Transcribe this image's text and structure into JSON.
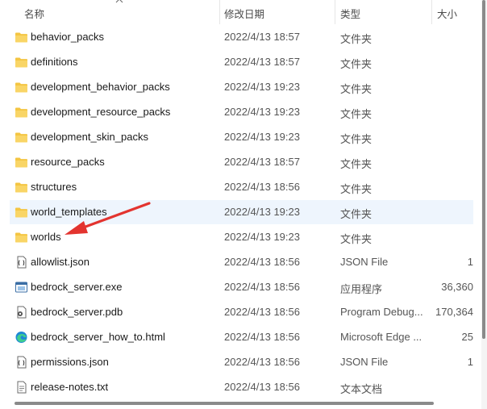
{
  "header": {
    "name": "名称",
    "date": "修改日期",
    "type": "类型",
    "size": "大小"
  },
  "files": [
    {
      "name": "behavior_packs",
      "date": "2022/4/13 18:57",
      "type": "文件夹",
      "size": "",
      "icon": "folder-icon"
    },
    {
      "name": "definitions",
      "date": "2022/4/13 18:57",
      "type": "文件夹",
      "size": "",
      "icon": "folder-icon"
    },
    {
      "name": "development_behavior_packs",
      "date": "2022/4/13 19:23",
      "type": "文件夹",
      "size": "",
      "icon": "folder-icon"
    },
    {
      "name": "development_resource_packs",
      "date": "2022/4/13 19:23",
      "type": "文件夹",
      "size": "",
      "icon": "folder-icon"
    },
    {
      "name": "development_skin_packs",
      "date": "2022/4/13 19:23",
      "type": "文件夹",
      "size": "",
      "icon": "folder-icon"
    },
    {
      "name": "resource_packs",
      "date": "2022/4/13 18:57",
      "type": "文件夹",
      "size": "",
      "icon": "folder-icon"
    },
    {
      "name": "structures",
      "date": "2022/4/13 18:56",
      "type": "文件夹",
      "size": "",
      "icon": "folder-icon"
    },
    {
      "name": "world_templates",
      "date": "2022/4/13 19:23",
      "type": "文件夹",
      "size": "",
      "icon": "folder-icon"
    },
    {
      "name": "worlds",
      "date": "2022/4/13 19:23",
      "type": "文件夹",
      "size": "",
      "icon": "folder-icon"
    },
    {
      "name": "allowlist.json",
      "date": "2022/4/13 18:56",
      "type": "JSON File",
      "size": "1",
      "icon": "json-file-icon"
    },
    {
      "name": "bedrock_server.exe",
      "date": "2022/4/13 18:56",
      "type": "应用程序",
      "size": "36,360",
      "icon": "exe-icon"
    },
    {
      "name": "bedrock_server.pdb",
      "date": "2022/4/13 18:56",
      "type": "Program Debug...",
      "size": "170,364",
      "icon": "pdb-file-icon"
    },
    {
      "name": "bedrock_server_how_to.html",
      "date": "2022/4/13 18:56",
      "type": "Microsoft Edge ...",
      "size": "25",
      "icon": "edge-icon"
    },
    {
      "name": "permissions.json",
      "date": "2022/4/13 18:56",
      "type": "JSON File",
      "size": "1",
      "icon": "json-file-icon"
    },
    {
      "name": "release-notes.txt",
      "date": "2022/4/13 18:56",
      "type": "文本文档",
      "size": "",
      "icon": "text-file-icon"
    }
  ],
  "colors": {
    "folder": "#f4c542",
    "hover_row": "#eef5fd",
    "annotation_arrow": "#e3342f"
  }
}
